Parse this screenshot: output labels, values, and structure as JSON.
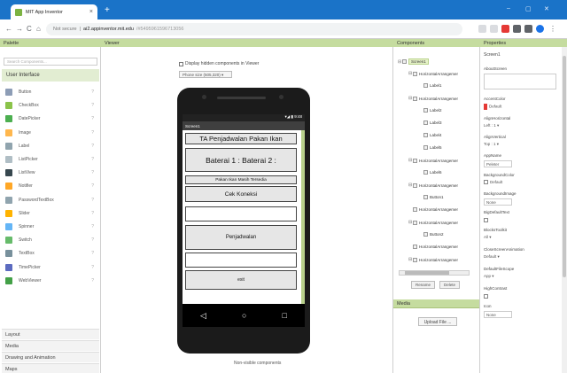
{
  "browser": {
    "tab_title": "MIT App Inventor",
    "tab_close": "×",
    "new_tab": "+",
    "nav_back": "←",
    "nav_forward": "→",
    "nav_reload": "C",
    "nav_home": "⌂",
    "url_secure": "Not secure",
    "url_host": "ai2.appinventor.mit.edu",
    "url_path": "/#5495961596713056",
    "win_min": "–",
    "win_max": "▢",
    "win_close": "✕"
  },
  "palette": {
    "header": "Palette",
    "search_placeholder": "Search Components...",
    "active_category": "User Interface",
    "items": [
      {
        "label": "Button",
        "color": "#8d9db6"
      },
      {
        "label": "CheckBox",
        "color": "#8bc34a"
      },
      {
        "label": "DatePicker",
        "color": "#4caf50"
      },
      {
        "label": "Image",
        "color": "#ffb74d"
      },
      {
        "label": "Label",
        "color": "#90a4ae"
      },
      {
        "label": "ListPicker",
        "color": "#b0bec5"
      },
      {
        "label": "ListView",
        "color": "#37474f"
      },
      {
        "label": "Notifier",
        "color": "#ffa726"
      },
      {
        "label": "PasswordTextBox",
        "color": "#90a4ae"
      },
      {
        "label": "Slider",
        "color": "#ffb300"
      },
      {
        "label": "Spinner",
        "color": "#64b5f6"
      },
      {
        "label": "Switch",
        "color": "#66bb6a"
      },
      {
        "label": "TextBox",
        "color": "#78909c"
      },
      {
        "label": "TimePicker",
        "color": "#5c6bc0"
      },
      {
        "label": "WebViewer",
        "color": "#43a047"
      }
    ],
    "help": "?",
    "categories": [
      "Layout",
      "Media",
      "Drawing and Animation",
      "Maps"
    ]
  },
  "viewer": {
    "header": "Viewer",
    "hidden_label": "Display hidden components in Viewer",
    "phone_size": "Phone size (505,320)",
    "status_time": "9:48",
    "screen_title": "Screen1",
    "title_text": "TA Penjadwalan Pakan Ikan",
    "baterai_text": "Baterai 1 :     Baterai 2 :",
    "pakan_text": "Pakan Ikan Masih Tersedia",
    "cek_text": "Cek Koneksi",
    "penjadwalan_text": "Penjadwalan",
    "exit_text": "exit",
    "nav_back": "◁",
    "nav_home": "○",
    "nav_recent": "□",
    "nonvisible": "Non-visible components"
  },
  "components": {
    "header": "Components",
    "tree": [
      {
        "label": "Screen1",
        "toggle": "⊟",
        "indent": 0,
        "selected": true
      },
      {
        "label": "HorizontalArrangemer",
        "toggle": "⊟",
        "indent": 1
      },
      {
        "label": "Label1",
        "toggle": "",
        "indent": 2
      },
      {
        "label": "HorizontalArrangemer",
        "toggle": "⊟",
        "indent": 1
      },
      {
        "label": "Label2",
        "toggle": "",
        "indent": 2
      },
      {
        "label": "Label3",
        "toggle": "",
        "indent": 2
      },
      {
        "label": "Label4",
        "toggle": "",
        "indent": 2
      },
      {
        "label": "Label5",
        "toggle": "",
        "indent": 2
      },
      {
        "label": "HorizontalArrangemer",
        "toggle": "⊟",
        "indent": 1
      },
      {
        "label": "Label6",
        "toggle": "",
        "indent": 2
      },
      {
        "label": "HorizontalArrangemer",
        "toggle": "⊟",
        "indent": 1
      },
      {
        "label": "Button1",
        "toggle": "",
        "indent": 2
      },
      {
        "label": "HorizontalArrangemer",
        "toggle": "",
        "indent": 1
      },
      {
        "label": "HorizontalArrangemer",
        "toggle": "⊟",
        "indent": 1
      },
      {
        "label": "Button2",
        "toggle": "",
        "indent": 2
      },
      {
        "label": "HorizontalArrangemer",
        "toggle": "",
        "indent": 1
      },
      {
        "label": "HorizontalArrangemer",
        "toggle": "⊟",
        "indent": 1
      }
    ],
    "rename": "Rename",
    "delete": "Delete"
  },
  "media": {
    "header": "Media",
    "upload": "Upload File ..."
  },
  "properties": {
    "header": "Properties",
    "component": "Screen1",
    "about_label": "AboutScreen",
    "accent_label": "AccentColor",
    "accent_value": "Default",
    "alignh_label": "AlignHorizontal",
    "alignh_value": "Left : 1 ▾",
    "alignv_label": "AlignVertical",
    "alignv_value": "Top : 1 ▾",
    "appname_label": "AppName",
    "appname_value": "Peleter",
    "bgcolor_label": "BackgroundColor",
    "bgcolor_value": "Default",
    "bgimage_label": "BackgroundImage",
    "bgimage_value": "None",
    "bigfont_label": "BigDefaultText",
    "blocks_label": "BlocksToolkit",
    "blocks_value": "All ▾",
    "closeanim_label": "CloseScreenAnimation",
    "closeanim_value": "Default ▾",
    "filescope_label": "DefaultFileScope",
    "filescope_value": "App ▾",
    "highcontrast_label": "HighContrast",
    "icon_label": "Icon",
    "icon_value": "None"
  }
}
